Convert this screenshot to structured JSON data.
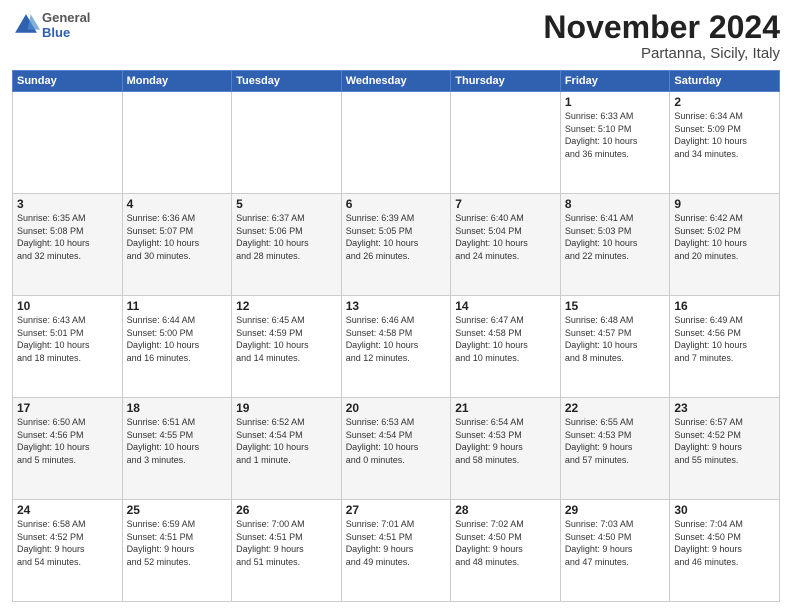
{
  "header": {
    "logo": {
      "general": "General",
      "blue": "Blue"
    },
    "title": "November 2024",
    "location": "Partanna, Sicily, Italy"
  },
  "calendar": {
    "days_of_week": [
      "Sunday",
      "Monday",
      "Tuesday",
      "Wednesday",
      "Thursday",
      "Friday",
      "Saturday"
    ],
    "weeks": [
      [
        {
          "day": "",
          "info": ""
        },
        {
          "day": "",
          "info": ""
        },
        {
          "day": "",
          "info": ""
        },
        {
          "day": "",
          "info": ""
        },
        {
          "day": "",
          "info": ""
        },
        {
          "day": "1",
          "info": "Sunrise: 6:33 AM\nSunset: 5:10 PM\nDaylight: 10 hours\nand 36 minutes."
        },
        {
          "day": "2",
          "info": "Sunrise: 6:34 AM\nSunset: 5:09 PM\nDaylight: 10 hours\nand 34 minutes."
        }
      ],
      [
        {
          "day": "3",
          "info": "Sunrise: 6:35 AM\nSunset: 5:08 PM\nDaylight: 10 hours\nand 32 minutes."
        },
        {
          "day": "4",
          "info": "Sunrise: 6:36 AM\nSunset: 5:07 PM\nDaylight: 10 hours\nand 30 minutes."
        },
        {
          "day": "5",
          "info": "Sunrise: 6:37 AM\nSunset: 5:06 PM\nDaylight: 10 hours\nand 28 minutes."
        },
        {
          "day": "6",
          "info": "Sunrise: 6:39 AM\nSunset: 5:05 PM\nDaylight: 10 hours\nand 26 minutes."
        },
        {
          "day": "7",
          "info": "Sunrise: 6:40 AM\nSunset: 5:04 PM\nDaylight: 10 hours\nand 24 minutes."
        },
        {
          "day": "8",
          "info": "Sunrise: 6:41 AM\nSunset: 5:03 PM\nDaylight: 10 hours\nand 22 minutes."
        },
        {
          "day": "9",
          "info": "Sunrise: 6:42 AM\nSunset: 5:02 PM\nDaylight: 10 hours\nand 20 minutes."
        }
      ],
      [
        {
          "day": "10",
          "info": "Sunrise: 6:43 AM\nSunset: 5:01 PM\nDaylight: 10 hours\nand 18 minutes."
        },
        {
          "day": "11",
          "info": "Sunrise: 6:44 AM\nSunset: 5:00 PM\nDaylight: 10 hours\nand 16 minutes."
        },
        {
          "day": "12",
          "info": "Sunrise: 6:45 AM\nSunset: 4:59 PM\nDaylight: 10 hours\nand 14 minutes."
        },
        {
          "day": "13",
          "info": "Sunrise: 6:46 AM\nSunset: 4:58 PM\nDaylight: 10 hours\nand 12 minutes."
        },
        {
          "day": "14",
          "info": "Sunrise: 6:47 AM\nSunset: 4:58 PM\nDaylight: 10 hours\nand 10 minutes."
        },
        {
          "day": "15",
          "info": "Sunrise: 6:48 AM\nSunset: 4:57 PM\nDaylight: 10 hours\nand 8 minutes."
        },
        {
          "day": "16",
          "info": "Sunrise: 6:49 AM\nSunset: 4:56 PM\nDaylight: 10 hours\nand 7 minutes."
        }
      ],
      [
        {
          "day": "17",
          "info": "Sunrise: 6:50 AM\nSunset: 4:56 PM\nDaylight: 10 hours\nand 5 minutes."
        },
        {
          "day": "18",
          "info": "Sunrise: 6:51 AM\nSunset: 4:55 PM\nDaylight: 10 hours\nand 3 minutes."
        },
        {
          "day": "19",
          "info": "Sunrise: 6:52 AM\nSunset: 4:54 PM\nDaylight: 10 hours\nand 1 minute."
        },
        {
          "day": "20",
          "info": "Sunrise: 6:53 AM\nSunset: 4:54 PM\nDaylight: 10 hours\nand 0 minutes."
        },
        {
          "day": "21",
          "info": "Sunrise: 6:54 AM\nSunset: 4:53 PM\nDaylight: 9 hours\nand 58 minutes."
        },
        {
          "day": "22",
          "info": "Sunrise: 6:55 AM\nSunset: 4:53 PM\nDaylight: 9 hours\nand 57 minutes."
        },
        {
          "day": "23",
          "info": "Sunrise: 6:57 AM\nSunset: 4:52 PM\nDaylight: 9 hours\nand 55 minutes."
        }
      ],
      [
        {
          "day": "24",
          "info": "Sunrise: 6:58 AM\nSunset: 4:52 PM\nDaylight: 9 hours\nand 54 minutes."
        },
        {
          "day": "25",
          "info": "Sunrise: 6:59 AM\nSunset: 4:51 PM\nDaylight: 9 hours\nand 52 minutes."
        },
        {
          "day": "26",
          "info": "Sunrise: 7:00 AM\nSunset: 4:51 PM\nDaylight: 9 hours\nand 51 minutes."
        },
        {
          "day": "27",
          "info": "Sunrise: 7:01 AM\nSunset: 4:51 PM\nDaylight: 9 hours\nand 49 minutes."
        },
        {
          "day": "28",
          "info": "Sunrise: 7:02 AM\nSunset: 4:50 PM\nDaylight: 9 hours\nand 48 minutes."
        },
        {
          "day": "29",
          "info": "Sunrise: 7:03 AM\nSunset: 4:50 PM\nDaylight: 9 hours\nand 47 minutes."
        },
        {
          "day": "30",
          "info": "Sunrise: 7:04 AM\nSunset: 4:50 PM\nDaylight: 9 hours\nand 46 minutes."
        }
      ]
    ]
  }
}
